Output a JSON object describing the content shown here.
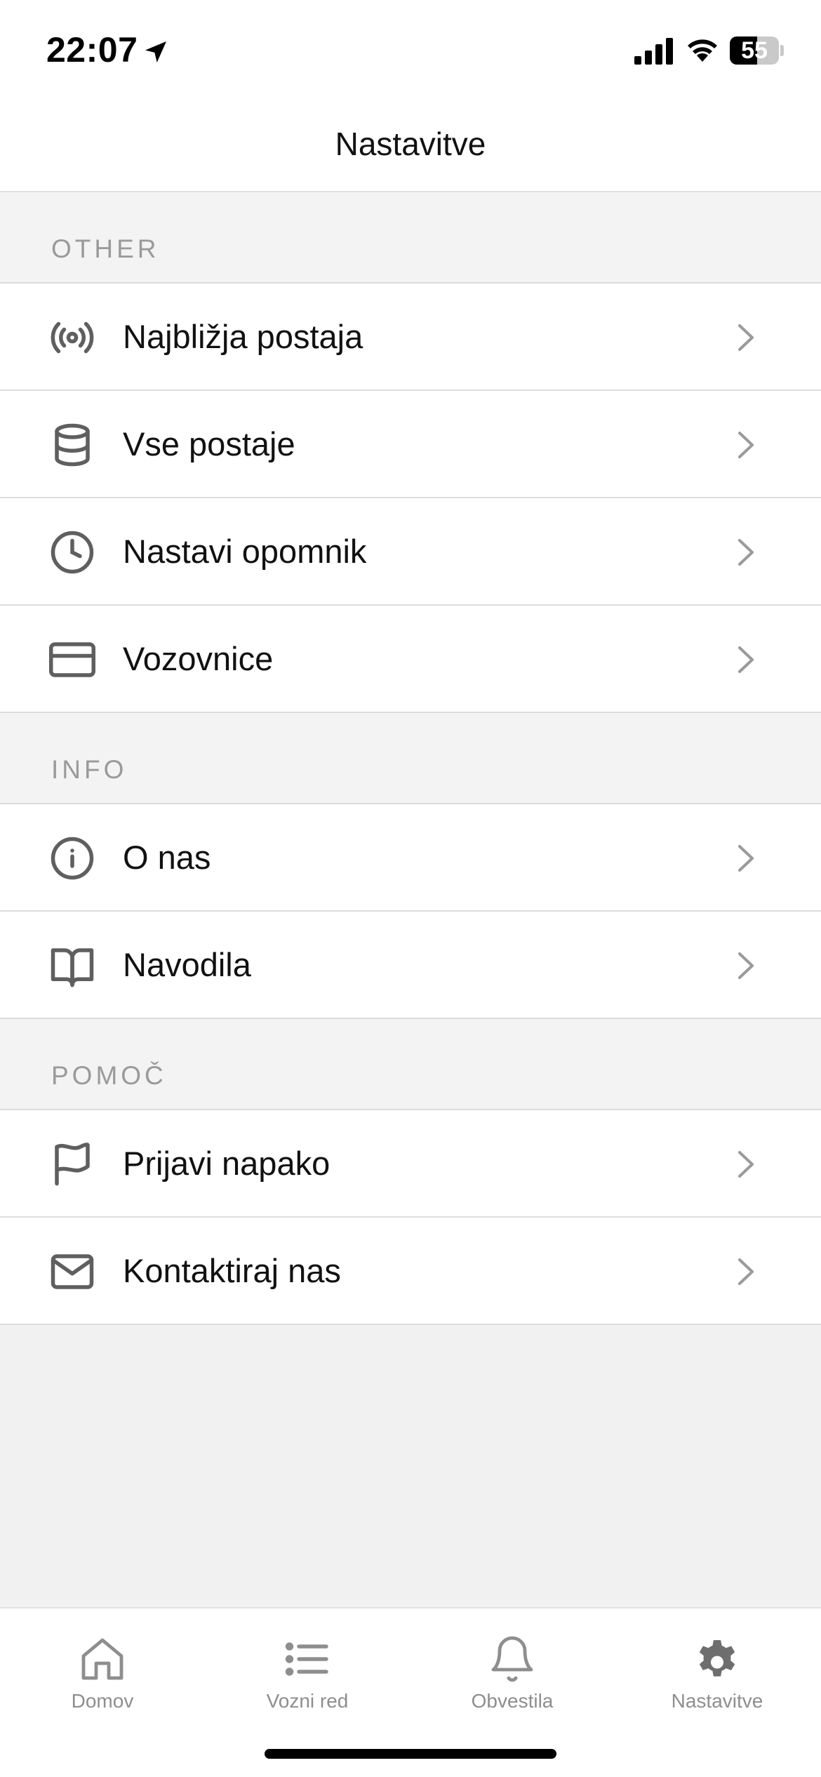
{
  "status_bar": {
    "time": "22:07",
    "battery_level": "55",
    "battery_fraction": 0.55
  },
  "nav": {
    "title": "Nastavitve"
  },
  "sections": [
    {
      "header": "OTHER",
      "items": [
        {
          "label": "Najbližja postaja",
          "icon": "broadcast-icon"
        },
        {
          "label": "Vse postaje",
          "icon": "database-icon"
        },
        {
          "label": "Nastavi opomnik",
          "icon": "clock-icon"
        },
        {
          "label": "Vozovnice",
          "icon": "card-icon"
        }
      ]
    },
    {
      "header": "INFO",
      "items": [
        {
          "label": "O nas",
          "icon": "info-icon"
        },
        {
          "label": "Navodila",
          "icon": "book-icon"
        }
      ]
    },
    {
      "header": "POMOČ",
      "items": [
        {
          "label": "Prijavi napako",
          "icon": "flag-icon"
        },
        {
          "label": "Kontaktiraj nas",
          "icon": "mail-icon"
        }
      ]
    }
  ],
  "tabs": [
    {
      "label": "Domov",
      "icon": "home-icon",
      "active": false
    },
    {
      "label": "Vozni red",
      "icon": "list-icon",
      "active": false
    },
    {
      "label": "Obvestila",
      "icon": "bell-icon",
      "active": false
    },
    {
      "label": "Nastavitve",
      "icon": "gear-icon",
      "active": true
    }
  ],
  "colors": {
    "icon_gray": "#5f5f5f",
    "chevron_gray": "#9a9a9a",
    "tab_gray": "#8e8e8e"
  }
}
